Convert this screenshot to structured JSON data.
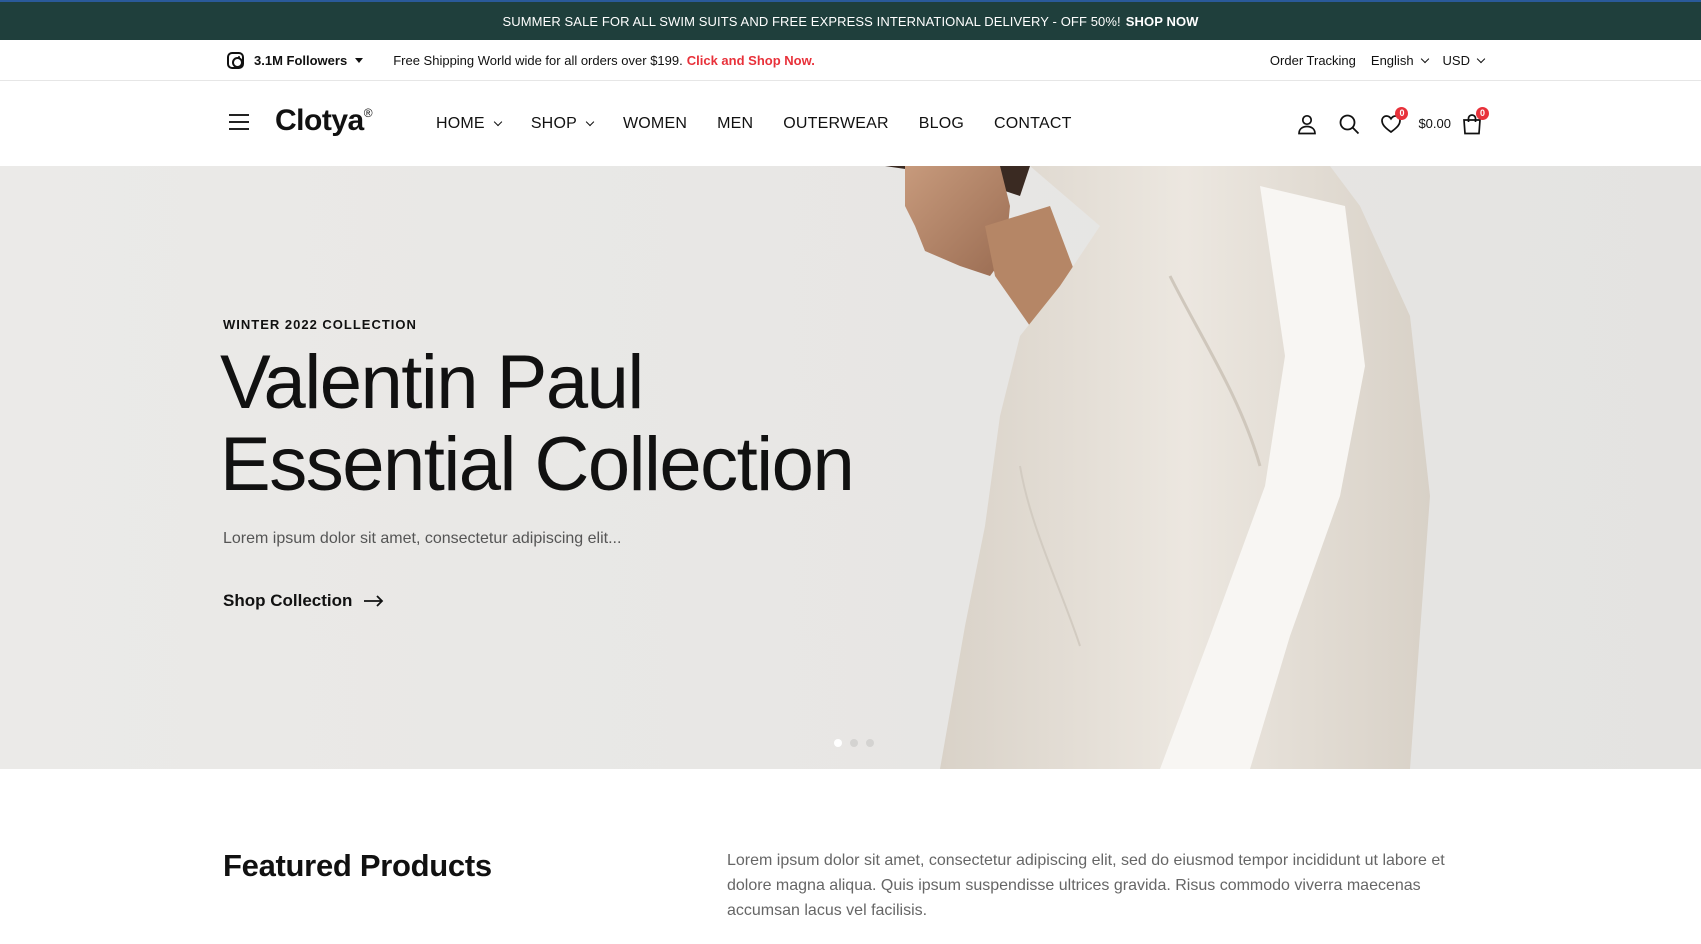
{
  "announcement": {
    "text": "SUMMER SALE FOR ALL SWIM SUITS AND FREE EXPRESS INTERNATIONAL DELIVERY - OFF 50%!",
    "cta": "SHOP NOW"
  },
  "topbar": {
    "followers": "3.1M Followers",
    "shipping_text": "Free Shipping World wide for all orders over $199.",
    "shipping_link": "Click and Shop Now.",
    "order_tracking": "Order Tracking",
    "language": "English",
    "currency": "USD"
  },
  "header": {
    "logo": "Clotya",
    "logo_mark": "®",
    "nav": {
      "home": "HOME",
      "shop": "SHOP",
      "women": "WOMEN",
      "men": "MEN",
      "outerwear": "OUTERWEAR",
      "blog": "BLOG",
      "contact": "CONTACT"
    },
    "wishlist_count": "0",
    "cart_total": "$0.00",
    "cart_count": "0"
  },
  "hero": {
    "eyebrow": "WINTER 2022 COLLECTION",
    "title_line1": "Valentin Paul",
    "title_line2": "Essential Collection",
    "subtitle": "Lorem ipsum dolor sit amet, consectetur adipiscing elit...",
    "cta": "Shop Collection",
    "slides": 3,
    "active_slide": 1
  },
  "featured": {
    "title": "Featured Products",
    "description": "Lorem ipsum dolor sit amet, consectetur adipiscing elit, sed do eiusmod tempor incididunt ut labore et dolore magna aliqua. Quis ipsum suspendisse ultrices gravida. Risus commodo viverra maecenas accumsan lacus vel facilisis."
  },
  "colors": {
    "announcement_bg": "#1f3f3c",
    "accent_red": "#e8313a",
    "hero_bg": "#e9e8e6"
  }
}
